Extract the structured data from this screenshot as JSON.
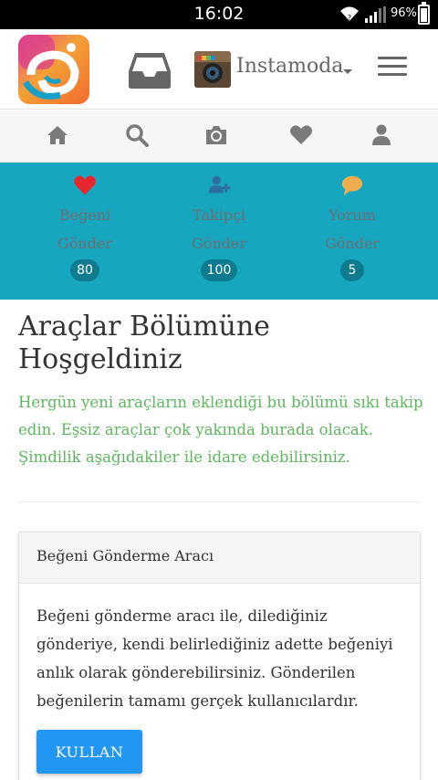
{
  "status_bar": {
    "time": "16:02",
    "battery": "96%",
    "battery_level": 0.96
  },
  "header": {
    "username": "Instamoda",
    "logo_icon": "app-logo",
    "inbox_icon": "inbox-icon",
    "menu_icon": "hamburger-menu-icon"
  },
  "nav": {
    "icons": [
      "home-icon",
      "search-icon",
      "camera-icon",
      "heart-icon",
      "user-icon"
    ],
    "color": "#7a7a7a"
  },
  "stats": {
    "background": "#17a6c0",
    "items": [
      {
        "label_line1": "Beğeni",
        "label_line2": "Gönder",
        "count": "80",
        "icon": "heart-icon",
        "icon_color": "#e8262d"
      },
      {
        "label_line1": "Takipçi",
        "label_line2": "Gönder",
        "count": "100",
        "icon": "user-plus-icon",
        "icon_color": "#2e6da4"
      },
      {
        "label_line1": "Yorum",
        "label_line2": "Gönder",
        "count": "5",
        "icon": "comment-icon",
        "icon_color": "#f0ad4e"
      }
    ]
  },
  "main": {
    "title": "Araçlar Bölümüne Hoşgeldiniz",
    "intro": "Hergün yeni araçların eklendiği bu bölümü sıkı takip edin. Eşsiz araçlar çok yakında burada olacak. Şimdilik aşağıdakiler ile idare edebilirsiniz.",
    "intro_color": "#5cb85c"
  },
  "card": {
    "title": "Beğeni Gönderme Aracı",
    "body": "Beğeni gönderme aracı ile, dilediğiniz gönderiye, kendi belirlediğiniz adette beğeniyi anlık olarak gönderebilirsiniz. Gönderilen beğenilerin tamamı gerçek kullanıcılardır.",
    "button_label": "KULLAN",
    "button_color": "#2196f3"
  }
}
